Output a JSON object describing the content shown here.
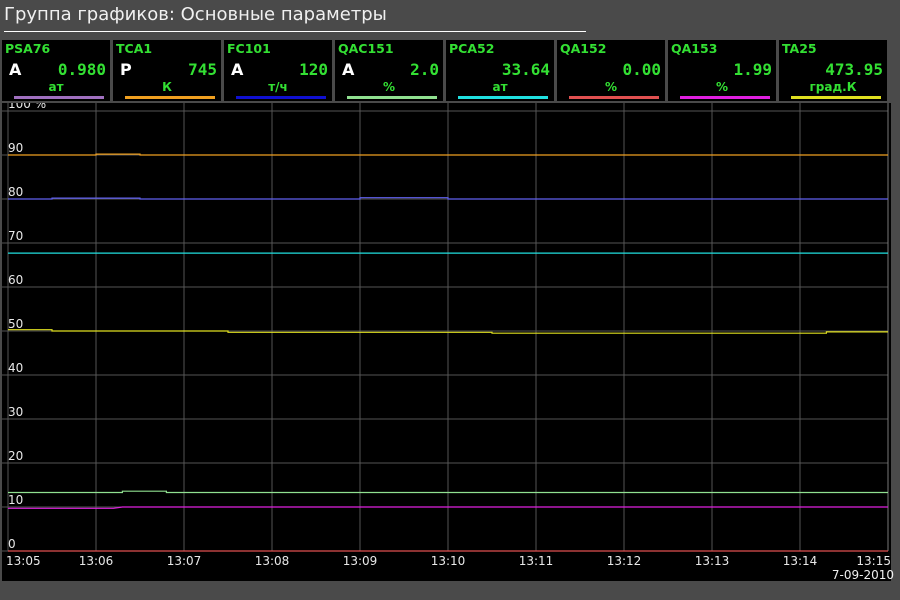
{
  "window": {
    "title": "Группа графиков: Основные параметры"
  },
  "tiles": [
    {
      "name": "PSA76",
      "mode": "A",
      "value": "0.980",
      "unit": "ат",
      "color": "#a070c0"
    },
    {
      "name": "TCA1",
      "mode": "P",
      "value": "745",
      "unit": "К",
      "color": "#f0a020"
    },
    {
      "name": "FC101",
      "mode": "A",
      "value": "120",
      "unit": "т/ч",
      "color": "#1010d0"
    },
    {
      "name": "QAC151",
      "mode": "A",
      "value": "2.0",
      "unit": "%",
      "color": "#90e090"
    },
    {
      "name": "PCA52",
      "mode": "",
      "value": "33.64",
      "unit": "ат",
      "color": "#20e0e0"
    },
    {
      "name": "QA152",
      "mode": "",
      "value": "0.00",
      "unit": "%",
      "color": "#e05050"
    },
    {
      "name": "QA153",
      "mode": "",
      "value": "1.99",
      "unit": "%",
      "color": "#e020e0"
    },
    {
      "name": "TA25",
      "mode": "",
      "value": "473.95",
      "unit": "град.К",
      "color": "#e0e020"
    }
  ],
  "date": "7-09-2010",
  "chart_data": {
    "type": "line",
    "ylim": [
      0,
      100
    ],
    "y_ticks": [
      "100 %",
      "90",
      "80",
      "70",
      "60",
      "50",
      "40",
      "30",
      "20",
      "10",
      "0"
    ],
    "x_ticks": [
      "13:05",
      "13:06",
      "13:07",
      "13:08",
      "13:09",
      "13:10",
      "13:11",
      "13:12",
      "13:13",
      "13:14",
      "13:15"
    ],
    "x_range": [
      "13:05",
      "13:15"
    ],
    "grid": true,
    "series": [
      {
        "color": "#f0a020",
        "points": [
          [
            0,
            90.0
          ],
          [
            1.0,
            90.0
          ],
          [
            1.0,
            90.2
          ],
          [
            1.5,
            90.2
          ],
          [
            1.5,
            90.0
          ],
          [
            10.0,
            90.0
          ]
        ]
      },
      {
        "color": "#6060f0",
        "points": [
          [
            0,
            80.0
          ],
          [
            0.5,
            80.0
          ],
          [
            0.5,
            80.2
          ],
          [
            1.5,
            80.2
          ],
          [
            1.5,
            80.0
          ],
          [
            4.0,
            80.0
          ],
          [
            4.0,
            80.3
          ],
          [
            5.0,
            80.3
          ],
          [
            5.0,
            80.0
          ],
          [
            10.0,
            80.0
          ]
        ]
      },
      {
        "color": "#20e0e0",
        "points": [
          [
            0,
            67.7
          ],
          [
            10.0,
            67.7
          ]
        ]
      },
      {
        "color": "#e0e020",
        "points": [
          [
            0,
            50.3
          ],
          [
            0.5,
            50.3
          ],
          [
            0.5,
            50.0
          ],
          [
            2.5,
            50.0
          ],
          [
            2.5,
            49.7
          ],
          [
            5.5,
            49.7
          ],
          [
            5.5,
            49.5
          ],
          [
            9.3,
            49.5
          ],
          [
            9.3,
            49.8
          ],
          [
            10.0,
            49.8
          ]
        ]
      },
      {
        "color": "#90e090",
        "points": [
          [
            0,
            13.3
          ],
          [
            1.3,
            13.3
          ],
          [
            1.3,
            13.6
          ],
          [
            1.8,
            13.6
          ],
          [
            1.8,
            13.3
          ],
          [
            10.0,
            13.3
          ]
        ]
      },
      {
        "color": "#e020e0",
        "points": [
          [
            0,
            9.7
          ],
          [
            1.2,
            9.7
          ],
          [
            1.3,
            10.0
          ],
          [
            10.0,
            10.0
          ]
        ]
      },
      {
        "color": "#e05050",
        "points": [
          [
            0,
            0.0
          ],
          [
            10.0,
            0.0
          ]
        ]
      }
    ]
  }
}
